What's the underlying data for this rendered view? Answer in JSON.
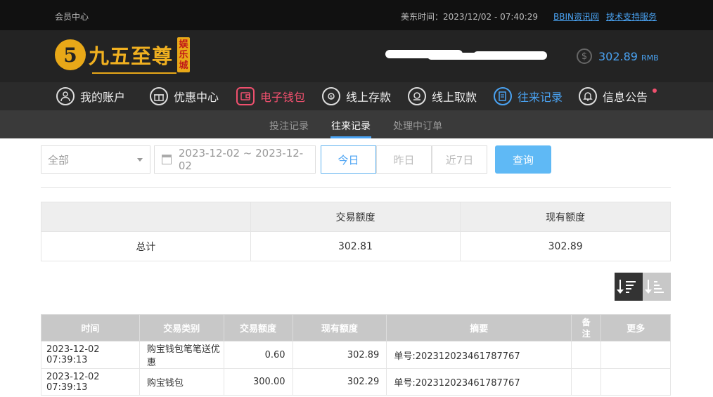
{
  "topbar": {
    "member_center": "会员中心",
    "time_label": "美东时间：2023/12/02 - 07:40:29",
    "link_bbin": "BBIN资讯网",
    "link_support": "技术支持服务"
  },
  "header": {
    "logo_mark": "5",
    "logo_text": "九五至尊",
    "logo_sub": [
      "娱",
      "乐",
      "城"
    ],
    "balance": "302.89",
    "currency": "RMB",
    "coin_symbol": "$"
  },
  "nav": {
    "items": [
      {
        "label": "我的账户",
        "icon": "user-icon"
      },
      {
        "label": "优惠中心",
        "icon": "gift-icon"
      },
      {
        "label": "电子钱包",
        "icon": "wallet-icon"
      },
      {
        "label": "线上存款",
        "icon": "deposit-icon"
      },
      {
        "label": "线上取款",
        "icon": "withdraw-icon"
      },
      {
        "label": "往来记录",
        "icon": "record-icon"
      },
      {
        "label": "信息公告",
        "icon": "bell-icon"
      }
    ]
  },
  "subnav": {
    "tabs": [
      "投注记录",
      "往来记录",
      "处理中订单"
    ],
    "active": "往来记录"
  },
  "filter": {
    "category": "全部",
    "date_range": "2023-12-02 ~ 2023-12-02",
    "quick": [
      "今日",
      "昨日",
      "近7日"
    ],
    "search": "查询"
  },
  "summary": {
    "headers": [
      "",
      "交易额度",
      "现有额度"
    ],
    "row": [
      "总计",
      "302.81",
      "302.89"
    ]
  },
  "records": {
    "headers": [
      "时间",
      "交易类别",
      "交易额度",
      "现有额度",
      "摘要",
      "备注",
      "更多"
    ],
    "rows": [
      [
        "2023-12-02 07:39:13",
        "购宝钱包笔笔送优惠",
        "0.60",
        "302.89",
        "单号:202312023461787767",
        "",
        ""
      ],
      [
        "2023-12-02 07:39:13",
        "购宝钱包",
        "300.00",
        "302.29",
        "单号:202312023461787767",
        "",
        ""
      ]
    ]
  },
  "colors": {
    "accent": "#4aa3f3",
    "active_red": "#f0506e",
    "gold": "#e8a818"
  }
}
